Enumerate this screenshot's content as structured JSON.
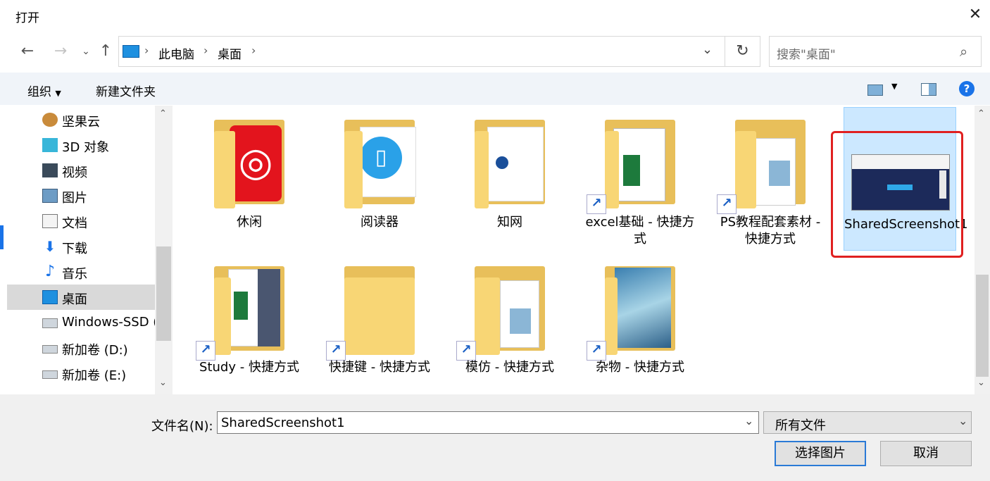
{
  "window": {
    "title": "打开"
  },
  "nav": {
    "breadcrumb": [
      "此电脑",
      "桌面"
    ],
    "search_placeholder": "搜索\"桌面\""
  },
  "toolbar": {
    "organize": "组织",
    "new_folder": "新建文件夹"
  },
  "sidebar": {
    "items": [
      {
        "label": "坚果云",
        "icon": "nut-icon"
      },
      {
        "label": "3D 对象",
        "icon": "cube-3d-icon"
      },
      {
        "label": "视频",
        "icon": "video-icon"
      },
      {
        "label": "图片",
        "icon": "picture-icon"
      },
      {
        "label": "文档",
        "icon": "document-icon"
      },
      {
        "label": "下载",
        "icon": "download-icon"
      },
      {
        "label": "音乐",
        "icon": "music-icon"
      },
      {
        "label": "桌面",
        "icon": "desktop-icon",
        "selected": true
      },
      {
        "label": "Windows-SSD (",
        "icon": "drive-os-icon"
      },
      {
        "label": "新加卷 (D:)",
        "icon": "drive-icon"
      },
      {
        "label": "新加卷 (E:)",
        "icon": "drive-icon"
      }
    ]
  },
  "files": [
    {
      "label": "休闲",
      "type": "folder",
      "overlay": "netease-music"
    },
    {
      "label": "阅读器",
      "type": "folder",
      "overlay": "reader"
    },
    {
      "label": "知网",
      "type": "folder",
      "overlay": "cnki"
    },
    {
      "label": "excel基础 - 快捷方式",
      "type": "shortcut"
    },
    {
      "label": "PS教程配套素材 - 快捷方式",
      "type": "shortcut"
    },
    {
      "label": "SharedScreenshot1",
      "type": "image",
      "selected": true
    },
    {
      "label": "Study - 快捷方式",
      "type": "shortcut"
    },
    {
      "label": "快捷键 - 快捷方式",
      "type": "shortcut"
    },
    {
      "label": "模仿 - 快捷方式",
      "type": "shortcut"
    },
    {
      "label": "杂物 - 快捷方式",
      "type": "shortcut"
    }
  ],
  "footer": {
    "filename_label": "文件名(N):",
    "filename_value": "SharedScreenshot1",
    "filetype_value": "所有文件",
    "open_button": "选择图片",
    "cancel_button": "取消"
  },
  "colors": {
    "selection": "#cce8ff",
    "highlight_box": "#e02020",
    "accent": "#0078d7"
  }
}
